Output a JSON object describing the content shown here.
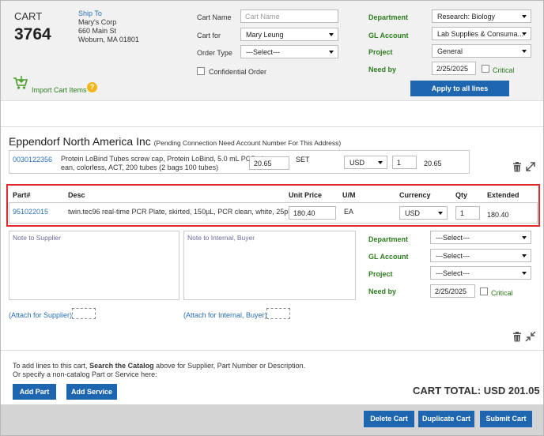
{
  "cart": {
    "label": "CART",
    "number": "3764",
    "ship_to_label": "Ship To",
    "ship_to_lines": [
      "Mary's Corp",
      "660 Main St",
      "Woburn, MA 01801"
    ]
  },
  "header": {
    "cart_name_label": "Cart Name",
    "cart_name_placeholder": "Cart Name",
    "cart_for_label": "Cart for",
    "cart_for_value": "Mary Leung",
    "order_type_label": "Order Type",
    "order_type_value": "---Select---",
    "confidential_label": "Confidential Order",
    "department_label": "Department",
    "department_value": "Research: Biology",
    "gl_label": "GL Account",
    "gl_value": "Lab Supplies & Consuma...",
    "project_label": "Project",
    "project_value": "General",
    "need_by_label": "Need by",
    "need_by_value": "2/25/2025",
    "critical_label": "Critical",
    "apply_label": "Apply to all lines",
    "import_label": "Import Cart Items",
    "help_glyph": "?"
  },
  "supplier": {
    "name": "Eppendorf North America Inc",
    "note": "(Pending Connection Need Account Number For This Address)"
  },
  "line1": {
    "part": "0030122356",
    "desc1": "Protein LoBind Tubes screw cap, Protein LoBind, 5.0 mL PCR cl",
    "desc2": "ean, colorless, ACT, 200 tubes (2 bags 100 tubes)",
    "price": "20.65",
    "um": "SET",
    "currency": "USD",
    "qty": "1",
    "extended": "20.65"
  },
  "line2": {
    "headers": {
      "part": "Part#",
      "desc": "Desc",
      "price": "Unit Price",
      "um": "U/M",
      "currency": "Currency",
      "qty": "Qty",
      "extended": "Extended"
    },
    "part": "951022015",
    "desc": "twin.tec96 real-time PCR Plate, skirted, 150µL, PCR clean, white, 25plates",
    "price": "180.40",
    "um": "EA",
    "currency": "USD",
    "qty": "1",
    "extended": "180.40"
  },
  "details": {
    "note_supplier": "Note to Supplier",
    "note_internal": "Note to Internal, Buyer",
    "department_label": "Department",
    "department_value": "---Select---",
    "gl_label": "GL Account",
    "gl_value": "---Select---",
    "project_label": "Project",
    "project_value": "---Select---",
    "need_by_label": "Need by",
    "need_by_value": "2/25/2025",
    "critical_label": "Critical",
    "attach_supplier": "(Attach for Supplier)",
    "attach_internal": "(Attach for Internal, Buyer)"
  },
  "bottom": {
    "instr_prefix": "To add lines to this cart, ",
    "instr_bold": "Search the Catalog",
    "instr_suffix": " above for Supplier, Part Number or Description.",
    "instr_line2": "Or specify a non-catalog Part or Service here:",
    "add_part": "Add Part",
    "add_service": "Add Service",
    "total": "CART TOTAL: USD 201.05"
  },
  "footer": {
    "delete": "Delete Cart",
    "duplicate": "Duplicate Cart",
    "submit": "Submit Cart"
  },
  "colors": {
    "accent_blue": "#1f66b1",
    "label_green": "#2d7d1f",
    "highlight_red": "#e0282e"
  }
}
